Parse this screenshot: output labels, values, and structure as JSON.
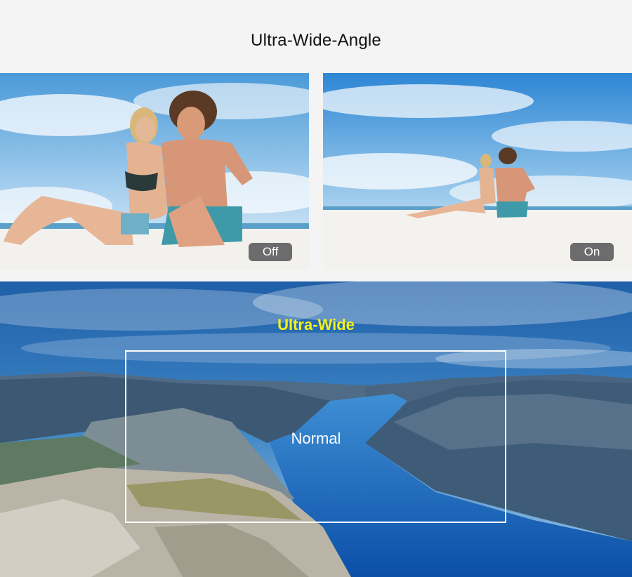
{
  "page": {
    "title": "Ultra-Wide-Angle"
  },
  "comparison": {
    "off_label": "Off",
    "on_label": "On"
  },
  "fov_demo": {
    "wide_label": "Ultra-Wide",
    "normal_label": "Normal",
    "colors": {
      "wide_label": "#f2f21a",
      "frame": "#ffffff"
    }
  }
}
